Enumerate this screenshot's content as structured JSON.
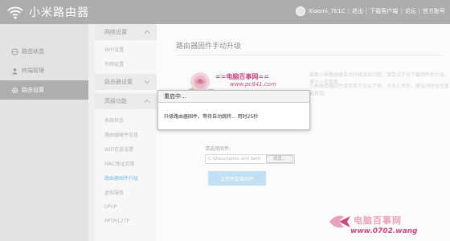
{
  "header": {
    "app_title": "小米路由器",
    "device_name": "Xiaomi_7E1C",
    "links": [
      "退出",
      "下载客户端",
      "论坛",
      "官方账号"
    ]
  },
  "sidebar": {
    "items": [
      {
        "label": "路由状态",
        "icon": "globe-icon"
      },
      {
        "label": "终端管理",
        "icon": "user-icon"
      },
      {
        "label": "路由设置",
        "icon": "gear-icon"
      }
    ]
  },
  "submenu": {
    "groups": [
      {
        "label": "网络设置"
      },
      {
        "label": "路由器设置"
      },
      {
        "label": "高级功能"
      }
    ],
    "network_items": [
      "WiFi设置",
      "外网设置"
    ],
    "advanced_items": [
      "系统状态",
      "路由器硬件信息",
      "WiFi信道设置",
      "MAC地址克隆",
      "路由器固件升级",
      "虚拟服务",
      "UPnP",
      "PPTP/L2TP"
    ]
  },
  "main": {
    "title": "路由器固件手动升级",
    "faint_line_1": "如果小米路由器自动升级出现问题，请尝试手动下载固件后升级，便于一次修复。",
    "faint_line_2": "小米路由器固件请到官方论坛下载，点击上传前，建议同时按住重启按钮。",
    "file_label": "请选择固件:",
    "file_value": "C:\\Documents and Setti",
    "browse_label": "浏览...",
    "upload_button": "上传并安装固件"
  },
  "dialog": {
    "title": "重启中...",
    "message": "升级路由器固件，等待自动跳转... 用时25秒"
  },
  "watermarks": {
    "top_line1": "==电脑百事网==",
    "top_line2": "www.pc841.com",
    "bottom_line1": "电脑百事网",
    "bottom_line2": "www.0702.wang"
  },
  "colors": {
    "topbar": "#8e8e8e",
    "sidebar_active": "#8f8f8f",
    "link_selected": "#4aa3d8",
    "upload_button": "#a9d4ef",
    "watermark": "#c94a82"
  }
}
